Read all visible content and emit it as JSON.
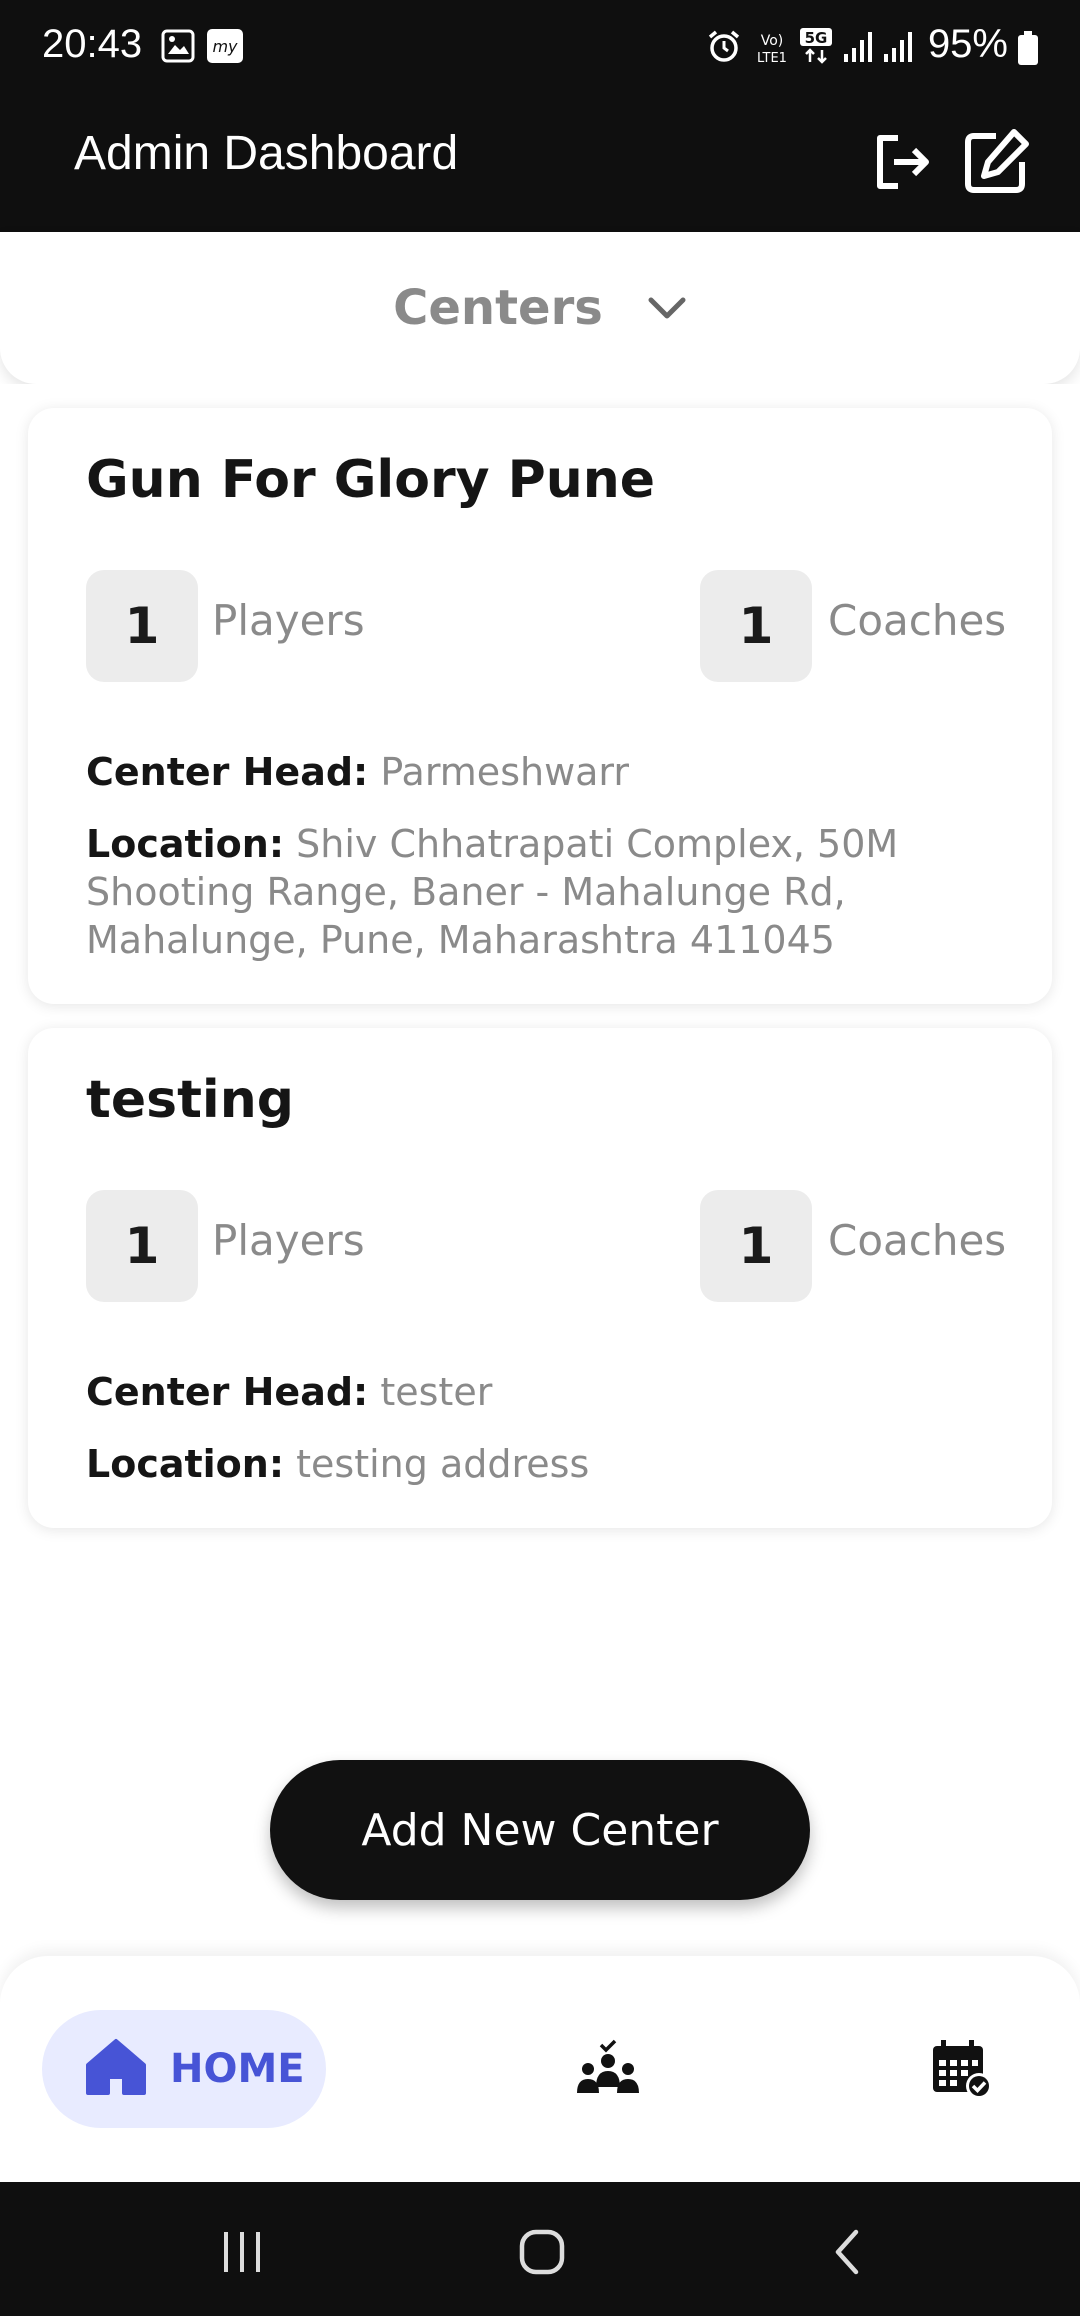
{
  "status_bar": {
    "time": "20:43",
    "battery": "95%",
    "left_icons": [
      "gallery-icon",
      "myapp-icon"
    ],
    "right_icons": [
      "alarm-icon",
      "volte-icon",
      "5g-icon",
      "signal-icon",
      "signal-icon",
      "battery-icon"
    ]
  },
  "header": {
    "title": "Admin Dashboard",
    "actions": [
      "logout-icon",
      "edit-icon"
    ]
  },
  "selector": {
    "label": "Centers"
  },
  "centers": [
    {
      "name": "Gun For Glory Pune",
      "players_count": "1",
      "players_label": "Players",
      "coaches_count": "1",
      "coaches_label": "Coaches",
      "head_key": "Center Head:",
      "head_value": "Parmeshwarr",
      "location_key": "Location:",
      "location_value": "Shiv Chhatrapati Complex, 50M Shooting Range, Baner - Mahalunge Rd, Mahalunge, Pune, Maharashtra 411045"
    },
    {
      "name": "testing",
      "players_count": "1",
      "players_label": "Players",
      "coaches_count": "1",
      "coaches_label": "Coaches",
      "head_key": "Center Head:",
      "head_value": "tester",
      "location_key": "Location:",
      "location_value": "testing address"
    }
  ],
  "add_button": {
    "label": "Add New Center"
  },
  "bottom_nav": {
    "home_label": "HOME",
    "active_color": "#4754d6",
    "items": [
      "home-icon",
      "team-icon",
      "calendar-check-icon"
    ]
  },
  "system_nav": [
    "recent-apps-icon",
    "home-circle-icon",
    "back-icon"
  ]
}
